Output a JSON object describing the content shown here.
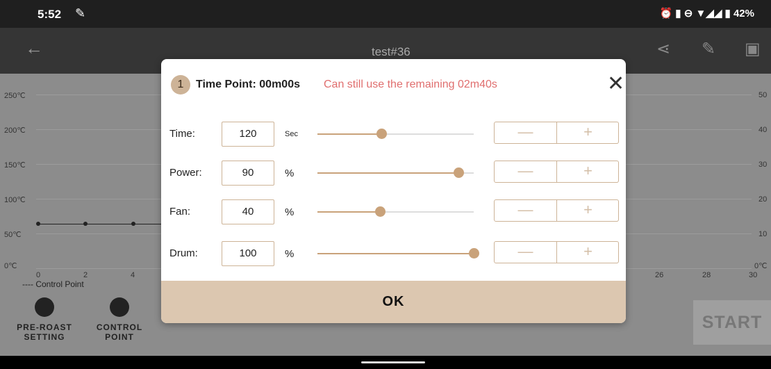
{
  "status": {
    "time": "5:52",
    "battery": "42%"
  },
  "appbar": {
    "title": "test#36"
  },
  "chart": {
    "y_left": [
      "250℃",
      "200℃",
      "150℃",
      "100℃",
      "50℃",
      "0℃"
    ],
    "y_right": [
      "50",
      "40",
      "30",
      "20",
      "10",
      "0℃"
    ],
    "x_ticks": [
      "0",
      "2",
      "4",
      "26",
      "28",
      "30"
    ],
    "legend": "---- Control Point"
  },
  "bottom": {
    "preroast_label": "PRE-ROAST\nSETTING",
    "control_label": "CONTROL\nPOINT",
    "start_label": "START"
  },
  "dialog": {
    "index": "1",
    "time_point": "Time Point: 00m00s",
    "remaining": "Can still use the remaining 02m40s",
    "close_glyph": "✕",
    "ok_label": "OK",
    "rows": [
      {
        "label": "Time:",
        "value": "120",
        "unit": "Sec",
        "fraction": 0.41
      },
      {
        "label": "Power:",
        "value": "90",
        "unit": "%",
        "fraction": 0.9
      },
      {
        "label": "Fan:",
        "value": "40",
        "unit": "%",
        "fraction": 0.4
      },
      {
        "label": "Drum:",
        "value": "100",
        "unit": "%",
        "fraction": 1.0
      }
    ],
    "minus_glyph": "—",
    "plus_glyph": "+"
  },
  "colors": {
    "accent": "#c9a27a",
    "remaining_text": "#e06e6e",
    "ok_bg": "#dcc7b0"
  }
}
